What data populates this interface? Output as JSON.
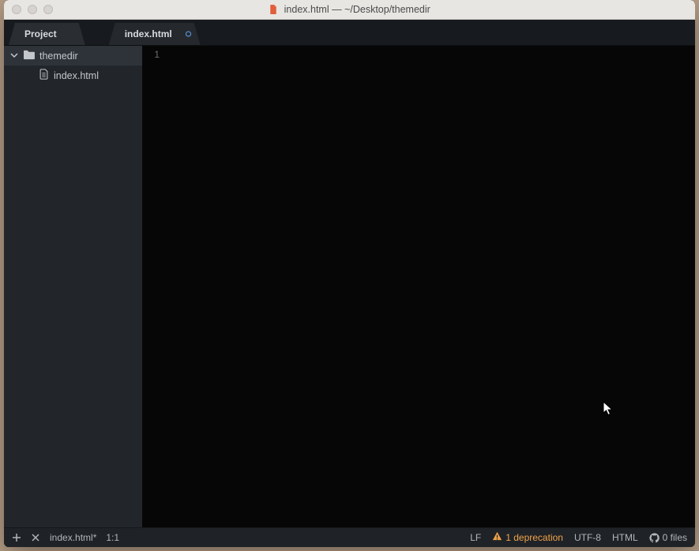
{
  "titlebar": {
    "title": "index.html — ~/Desktop/themedir"
  },
  "tabs": {
    "project_label": "Project",
    "file_label": "index.html"
  },
  "sidebar": {
    "folder": {
      "label": "themedir"
    },
    "files": [
      {
        "label": "index.html"
      }
    ]
  },
  "editor": {
    "line_numbers": [
      "1"
    ]
  },
  "statusbar": {
    "file": "index.html*",
    "cursor_pos": "1:1",
    "line_ending": "LF",
    "deprecation": "1 deprecation",
    "encoding": "UTF-8",
    "language": "HTML",
    "git_files": "0 files"
  }
}
